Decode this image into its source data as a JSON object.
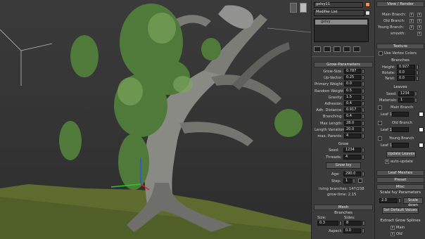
{
  "viewport": {
    "label": "viewport-perspective"
  },
  "modifier": {
    "object_name": "gxIvy11",
    "list_label": "Modifier List",
    "stack_item": "gxIvy"
  },
  "view_render": {
    "title": "View / Render",
    "main_branch": "Main Branch:",
    "old_branch": "Old Branch:",
    "young_branch": "Young Branch:",
    "smooth": "smooth:"
  },
  "texture": {
    "title": "Texture",
    "use_vertex": "Use Vertex Colors",
    "branches": "Branches",
    "height_label": "Height:",
    "height_val": "0.927",
    "rotate_label": "Rotate:",
    "rotate_val": "0.0",
    "twist_label": "Twist:",
    "twist_val": "0.0",
    "leaves": "Leaves",
    "seed_label": "Seed:",
    "seed_val": "1234",
    "materials_label": "Materials:",
    "materials_val": "1",
    "main_branch": "Main Branch",
    "old_branch": "Old Branch",
    "young_branch": "Young Branch",
    "leaf_label": "Leaf 1:",
    "update_leaves": "Update Leaves",
    "auto_update": "auto-update"
  },
  "leaf_meshes": {
    "title": "Leaf Meshes"
  },
  "preset": {
    "title": "Preset"
  },
  "misc": {
    "title": "Misc",
    "scale_params": "Scale Ivy Parameters",
    "scale_val": "2.0",
    "scale_down": "Scale down",
    "set_default": "Set Default Values",
    "extract": "Extract Grow Splines",
    "main": "Main",
    "old": "Old"
  },
  "grow": {
    "title": "Grow-Parameters",
    "rows": [
      {
        "label": "Grow-Size:",
        "val": "0.787"
      },
      {
        "label": "Up-Vector:",
        "val": "0.25"
      },
      {
        "label": "Primary Weight:",
        "val": "0.0"
      },
      {
        "label": "Random Weight:",
        "val": "0.5"
      },
      {
        "label": "Gravity:",
        "val": "1.5"
      },
      {
        "label": "Adhesion:",
        "val": "0.4"
      },
      {
        "label": "Adh. Distance:",
        "val": "0.917"
      },
      {
        "label": "Branching:",
        "val": "0.4"
      },
      {
        "label": "Max Length:",
        "val": "28.0"
      },
      {
        "label": "Length Variation:",
        "val": "20.0"
      },
      {
        "label": "max. Parents:",
        "val": "4"
      }
    ],
    "grow_sub": "Grow",
    "seed_label": "Seed:",
    "seed_val": "1234",
    "threads_label": "Threads:",
    "threads_val": "4",
    "grow_btn": "Grow Ivy",
    "age_label": "Age:",
    "age_val": "290.0",
    "step_label": "Step:",
    "step_val": "1",
    "living": "living branches: 147/238",
    "grow_time": "grow-time: 2.15"
  },
  "mesh": {
    "title": "Mesh",
    "branches": "Branches",
    "size_label": "Size:",
    "size_val": "0.3",
    "sides_label": "Sides:",
    "sides_val": "8",
    "aspect_label": "Aspect:",
    "aspect_val": "0.0"
  }
}
